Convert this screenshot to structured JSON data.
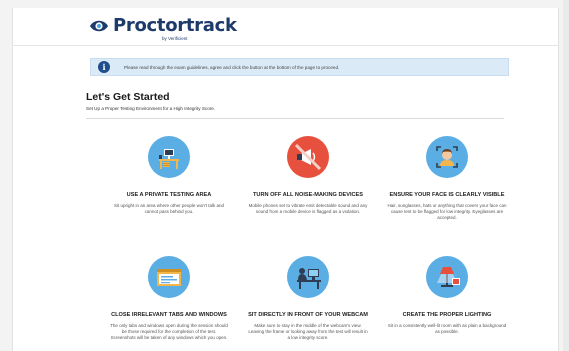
{
  "header": {
    "brand_name": "Proctortrack",
    "brand_sub": "by Verificient"
  },
  "notice": {
    "icon": "info-icon",
    "icon_glyph": "i",
    "text": "Please read through the exam guidelines, agree and click the button at the bottom of the page to proceed."
  },
  "main": {
    "title": "Let's Get Started",
    "subtitle": "Set Up a Proper Testing Environment for a High Integrity Score."
  },
  "colors": {
    "brand": "#1d3a6b",
    "circle_blue": "#5aaee3",
    "circle_red": "#e8503e",
    "notice_bg": "#dbeaf7"
  },
  "cards": [
    {
      "title": "USE A PRIVATE TESTING AREA",
      "desc": "Sit upright in an area where other people won't talk and cannot pass behind you.",
      "icon": "desk-icon"
    },
    {
      "title": "TURN OFF ALL NOISE-MAKING DEVICES",
      "desc": "Mobile phones set to vibrate emit detectable sound and any sound from a mobile device is flagged as a violation.",
      "icon": "no-megaphone-icon"
    },
    {
      "title": "ENSURE YOUR FACE IS CLEARLY VISIBLE",
      "desc": "Hair, sunglasses, hats or anything that covers your face can cause test to be flagged for low integrity. Eyeglasses are accepted.",
      "icon": "face-scan-icon"
    },
    {
      "title": "CLOSE IRRELEVANT TABS AND WINDOWS",
      "desc": "The only tabs and windows open during the session should be those required for the completion of the test. Screenshots will be taken of any windows which you open.",
      "icon": "browser-window-icon"
    },
    {
      "title": "SIT DIRECTLY IN FRONT OF YOUR WEBCAM",
      "desc": "Make sure to stay in the middle of the webcam's view. Leaving the frame or looking away from the test will result in a low integrity score.",
      "icon": "person-at-computer-icon"
    },
    {
      "title": "CREATE THE PROPER LIGHTING",
      "desc": "Sit in a consistently well-lit room with as plain a background as possible.",
      "icon": "lamp-icon"
    }
  ]
}
